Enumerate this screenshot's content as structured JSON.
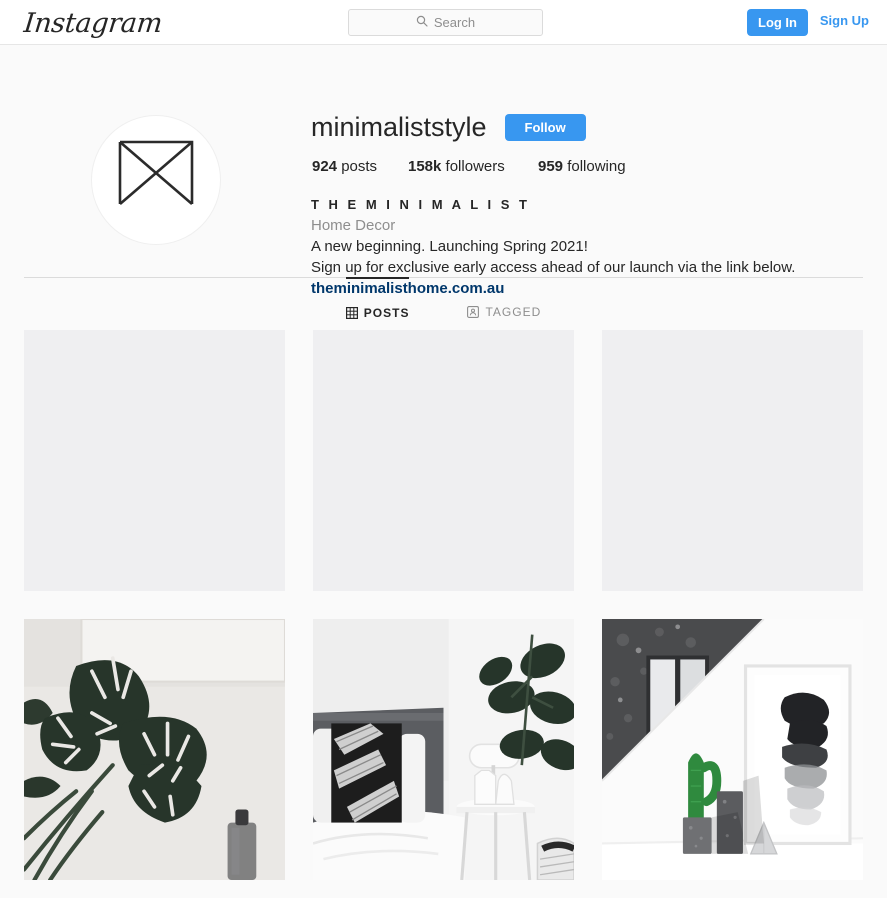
{
  "navbar": {
    "logo_text": "Instagram",
    "logo_icon": "instagram-wordmark",
    "search": {
      "placeholder": "Search",
      "value": "",
      "icon": "search-icon"
    },
    "login_label": "Log In",
    "signup_label": "Sign Up",
    "accent_color": "#3897f0"
  },
  "profile": {
    "avatar_icon": "square-with-x-logo",
    "username": "minimaliststyle",
    "follow_label": "Follow",
    "stats": {
      "posts_count": "924",
      "posts_label": "posts",
      "followers_count": "158k",
      "followers_label": "followers",
      "following_count": "959",
      "following_label": "following"
    },
    "bio": {
      "title": "T H E M I N I M A L I S T",
      "category": "Home Decor",
      "line1": "A new beginning. Launching Spring 2021!",
      "line2": "Sign up for exclusive early access ahead of our launch via the link below.",
      "link": "theminimalisthome.com.au",
      "link_color": "#00376b"
    }
  },
  "tabs": [
    {
      "label": "POSTS",
      "icon": "grid-icon",
      "active": true
    },
    {
      "label": "TAGGED",
      "icon": "tagged-person-icon",
      "active": false
    }
  ],
  "grid": {
    "placeholder_color": "#efeff1",
    "cells": [
      {
        "type": "placeholder",
        "name": "post-placeholder-1"
      },
      {
        "type": "placeholder",
        "name": "post-placeholder-2"
      },
      {
        "type": "placeholder",
        "name": "post-placeholder-3"
      },
      {
        "type": "photo",
        "name": "post-photo-monstera",
        "description": "Monstera plant leaves against white wall with dark glass bottle"
      },
      {
        "type": "photo",
        "name": "post-photo-bedroom",
        "description": "Bedroom with grey headboard, striped cushion, white side table with vases and fiddle leaf fig"
      },
      {
        "type": "photo",
        "name": "post-photo-cactus",
        "description": "Cactus in concrete pot beside cylinder, pyramid and framed stacked rocks print"
      }
    ]
  }
}
